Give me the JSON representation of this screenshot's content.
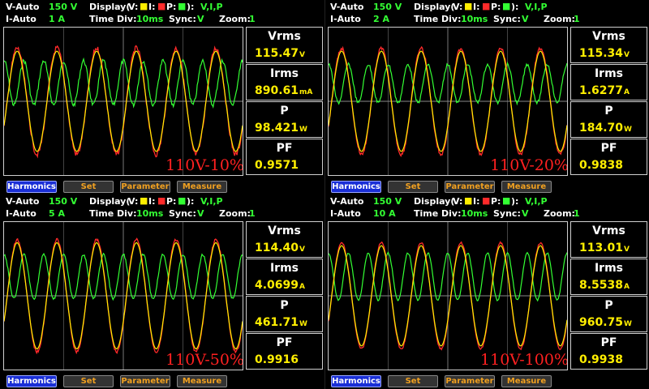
{
  "labels": {
    "vauto": "V-Auto",
    "iauto": "I-Auto",
    "display": "Display(",
    "v": "V:",
    "i": "I:",
    "p": "P:",
    "close": "):",
    "series": "V,I,P",
    "timediv": "Time  Div:",
    "sync": "Sync:",
    "sync_val": "V",
    "zoom": "Zoom:",
    "zoom_val": "1",
    "vrms": "Vrms",
    "irms": "Irms",
    "p_lbl": "P",
    "pf": "PF",
    "harmonics": "Harmonics",
    "set": "Set",
    "parameter": "Parameter",
    "measure": "Measure"
  },
  "colors": {
    "voltage": "#ffee00",
    "current": "#ff2a2a",
    "power": "#33ff33"
  },
  "panels": [
    {
      "v_range": "150  V",
      "i_range": "1  A",
      "time_div": "10ms",
      "vrms": "115.47",
      "vrms_unit": "V",
      "irms": "890.61",
      "irms_unit": "mA",
      "p": "98.421",
      "p_unit": "W",
      "pf": "0.9571",
      "tag": "110V-10%",
      "waves": {
        "v_amp": 0.34,
        "i_amp": 0.36,
        "p_amp": 0.3,
        "p_offset": 0.25,
        "noise": 0.06,
        "cycles": 6
      }
    },
    {
      "v_range": "150  V",
      "i_range": "2  A",
      "time_div": "10ms",
      "vrms": "115.34",
      "vrms_unit": "V",
      "irms": "1.6277",
      "irms_unit": "A",
      "p": "184.70",
      "p_unit": "W",
      "pf": "0.9838",
      "tag": "110V-20%",
      "waves": {
        "v_amp": 0.34,
        "i_amp": 0.36,
        "p_amp": 0.26,
        "p_offset": 0.24,
        "noise": 0.04,
        "cycles": 6
      }
    },
    {
      "v_range": "150  V",
      "i_range": "5  A",
      "time_div": "10ms",
      "vrms": "114.40",
      "vrms_unit": "V",
      "irms": "4.0699",
      "irms_unit": "A",
      "p": "461.71",
      "p_unit": "W",
      "pf": "0.9916",
      "tag": "110V-50%",
      "waves": {
        "v_amp": 0.36,
        "i_amp": 0.38,
        "p_amp": 0.3,
        "p_offset": 0.26,
        "noise": 0.03,
        "cycles": 6
      }
    },
    {
      "v_range": "150  V",
      "i_range": "10  A",
      "time_div": "10ms",
      "vrms": "113.01",
      "vrms_unit": "V",
      "irms": "8.5538",
      "irms_unit": "A",
      "p": "960.75",
      "p_unit": "W",
      "pf": "0.9938",
      "tag": "110V-100%",
      "waves": {
        "v_amp": 0.34,
        "i_amp": 0.36,
        "p_amp": 0.32,
        "p_offset": 0.26,
        "noise": 0.02,
        "cycles": 6
      }
    }
  ]
}
